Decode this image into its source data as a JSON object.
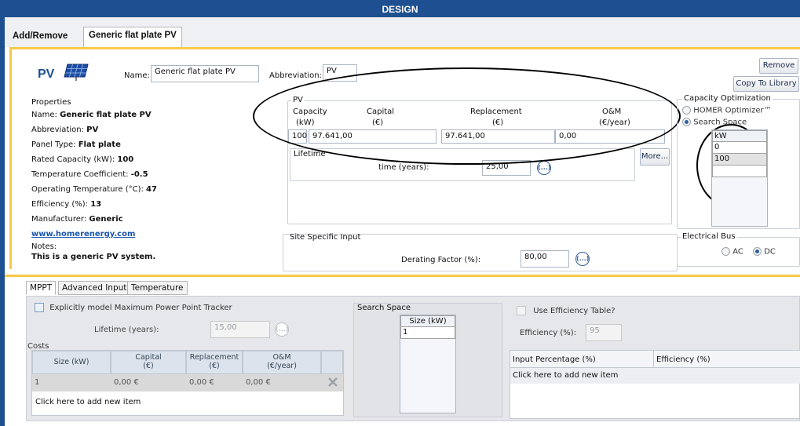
{
  "window": {
    "title": "DESIGN"
  },
  "tabs": [
    {
      "label": "Add/Remove"
    },
    {
      "label": "Generic flat plate PV"
    }
  ],
  "header": {
    "component_label": "PV",
    "name_label": "Name:",
    "name_value": "Generic flat plate PV",
    "abbrev_label": "Abbreviation:",
    "abbrev_value": "PV",
    "remove_label": "Remove",
    "copy_label": "Copy To Library"
  },
  "properties": {
    "title": "Properties",
    "rows": [
      {
        "label": "Name:",
        "value": "Generic flat plate PV"
      },
      {
        "label": "Abbreviation:",
        "value": "PV"
      },
      {
        "label": "Panel Type:",
        "value": "Flat plate"
      },
      {
        "label": "Rated Capacity (kW):",
        "value": "100"
      },
      {
        "label": "Temperature Coefficient:",
        "value": "-0.5"
      },
      {
        "label": "Operating Temperature (°C):",
        "value": "47"
      },
      {
        "label": "Efficiency (%):",
        "value": "13"
      },
      {
        "label": "Manufacturer:",
        "value": "Generic"
      }
    ],
    "link": "www.homerenergy.com",
    "notes_label": "Notes:",
    "notes_value": "This is a generic PV system."
  },
  "pv": {
    "title": "PV",
    "cols": [
      {
        "name": "Capacity",
        "unit": "(kW)",
        "value": "100"
      },
      {
        "name": "Capital",
        "unit": "(€)",
        "value": "97.641,00"
      },
      {
        "name": "Replacement",
        "unit": "(€)",
        "value": "97.641,00"
      },
      {
        "name": "O&M",
        "unit": "(€/year)",
        "value": "0,00"
      }
    ],
    "lifetime_title": "Lifetime",
    "lifetime_label": "time (years):",
    "lifetime_value": "25,00",
    "more_label": "More...",
    "ellipsis": "(...)"
  },
  "capacity_opt": {
    "title": "Capacity Optimization",
    "option1": "HOMER Optimizer™",
    "option2": "Search Space",
    "header": "kW",
    "values": [
      "0",
      "100"
    ]
  },
  "site": {
    "title": "Site Specific Input",
    "derating_label": "Derating Factor (%):",
    "derating_value": "80,00"
  },
  "bus": {
    "title": "Electrical Bus",
    "ac": "AC",
    "dc": "DC"
  },
  "bottom_tabs": [
    {
      "label": "MPPT"
    },
    {
      "label": "Advanced Input"
    },
    {
      "label": "Temperature"
    }
  ],
  "mppt": {
    "checkbox_label": "Explicitly model Maximum Power Point Tracker",
    "lifetime_label": "Lifetime (years):",
    "lifetime_value": "15,00",
    "costs_title": "Costs",
    "headers": [
      {
        "name": "Size (kW)",
        "unit": ""
      },
      {
        "name": "Capital",
        "unit": "(€)"
      },
      {
        "name": "Replacement",
        "unit": "(€)"
      },
      {
        "name": "O&M",
        "unit": "(€/year)"
      }
    ],
    "row": [
      "1",
      "0,00 €",
      "0,00 €",
      "0,00 €"
    ],
    "add_item": "Click here to add new item",
    "search_title": "Search Space",
    "search_header": "Size (kW)",
    "search_value": "1",
    "use_table": "Use Efficiency Table?",
    "efficiency_label": "Efficiency (%):",
    "efficiency_value": "95",
    "eff_headers": [
      "Input Percentage (%)",
      "Efficiency (%)"
    ],
    "eff_add_item": "Click here to add new item"
  },
  "colors": {
    "titlebar": "#1d4f91",
    "accent": "#f7c948",
    "link": "#1a55b0"
  }
}
